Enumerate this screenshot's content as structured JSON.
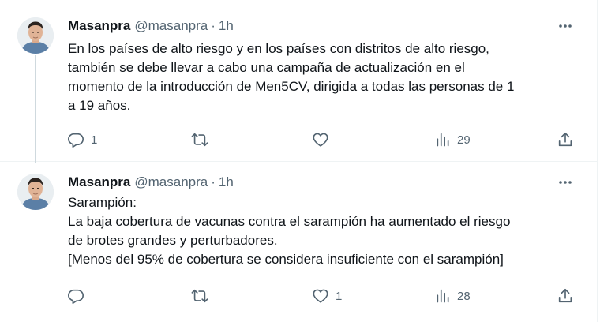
{
  "tweets": [
    {
      "author": {
        "name": "Masanpra",
        "handle": "@masanpra"
      },
      "separator": "·",
      "time": "1h",
      "lines": [
        "En los países de alto riesgo y en los países con distritos de alto riesgo,",
        "también se debe llevar a cabo una campaña de actualización en el",
        "momento de la introducción de Men5CV, dirigida a todas las personas de 1",
        "a 19 años."
      ],
      "stats": {
        "replies": "1",
        "retweets": "",
        "likes": "",
        "views": "29"
      }
    },
    {
      "author": {
        "name": "Masanpra",
        "handle": "@masanpra"
      },
      "separator": "·",
      "time": "1h",
      "lines": [
        "Sarampión:",
        "La baja cobertura de vacunas contra el sarampión ha aumentado el riesgo",
        "de brotes grandes y perturbadores.",
        "[Menos del 95% de cobertura se considera insuficiente con el sarampión]"
      ],
      "stats": {
        "replies": "",
        "retweets": "",
        "likes": "1",
        "views": "28"
      }
    }
  ],
  "icons": {
    "more": "more-horizontal-icon",
    "reply": "reply-icon",
    "retweet": "retweet-icon",
    "like": "heart-icon",
    "views": "views-bar-chart-icon",
    "share": "share-icon"
  },
  "colors": {
    "text": "#0f1419",
    "secondary": "#536471",
    "divider": "#eff3f4",
    "thread_line": "#cfd9de"
  }
}
